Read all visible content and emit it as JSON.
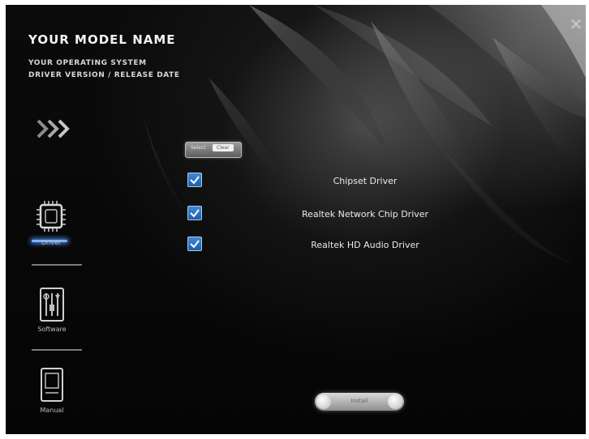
{
  "header": {
    "title": "YOUR MODEL NAME",
    "os_line": "YOUR OPERATING SYSTEM",
    "version_line": "DRIVER VERSION / RELEASE DATE"
  },
  "window": {
    "close_icon": "close-icon"
  },
  "sidebar": {
    "items": [
      {
        "label": "Driver",
        "icon": "chip-icon",
        "active": true
      },
      {
        "label": "Software",
        "icon": "tools-icon",
        "active": false
      },
      {
        "label": "Manual",
        "icon": "book-icon",
        "active": false
      }
    ],
    "accent_color": "#7fb0ff"
  },
  "select_toggle": {
    "left_label": "Select",
    "right_label": "Clear"
  },
  "drivers": [
    {
      "label": "Chipset Driver",
      "checked": true
    },
    {
      "label": "Realtek Network Chip Driver",
      "checked": true
    },
    {
      "label": "Realtek HD Audio Driver",
      "checked": true
    }
  ],
  "install_button": {
    "label": "Install"
  }
}
